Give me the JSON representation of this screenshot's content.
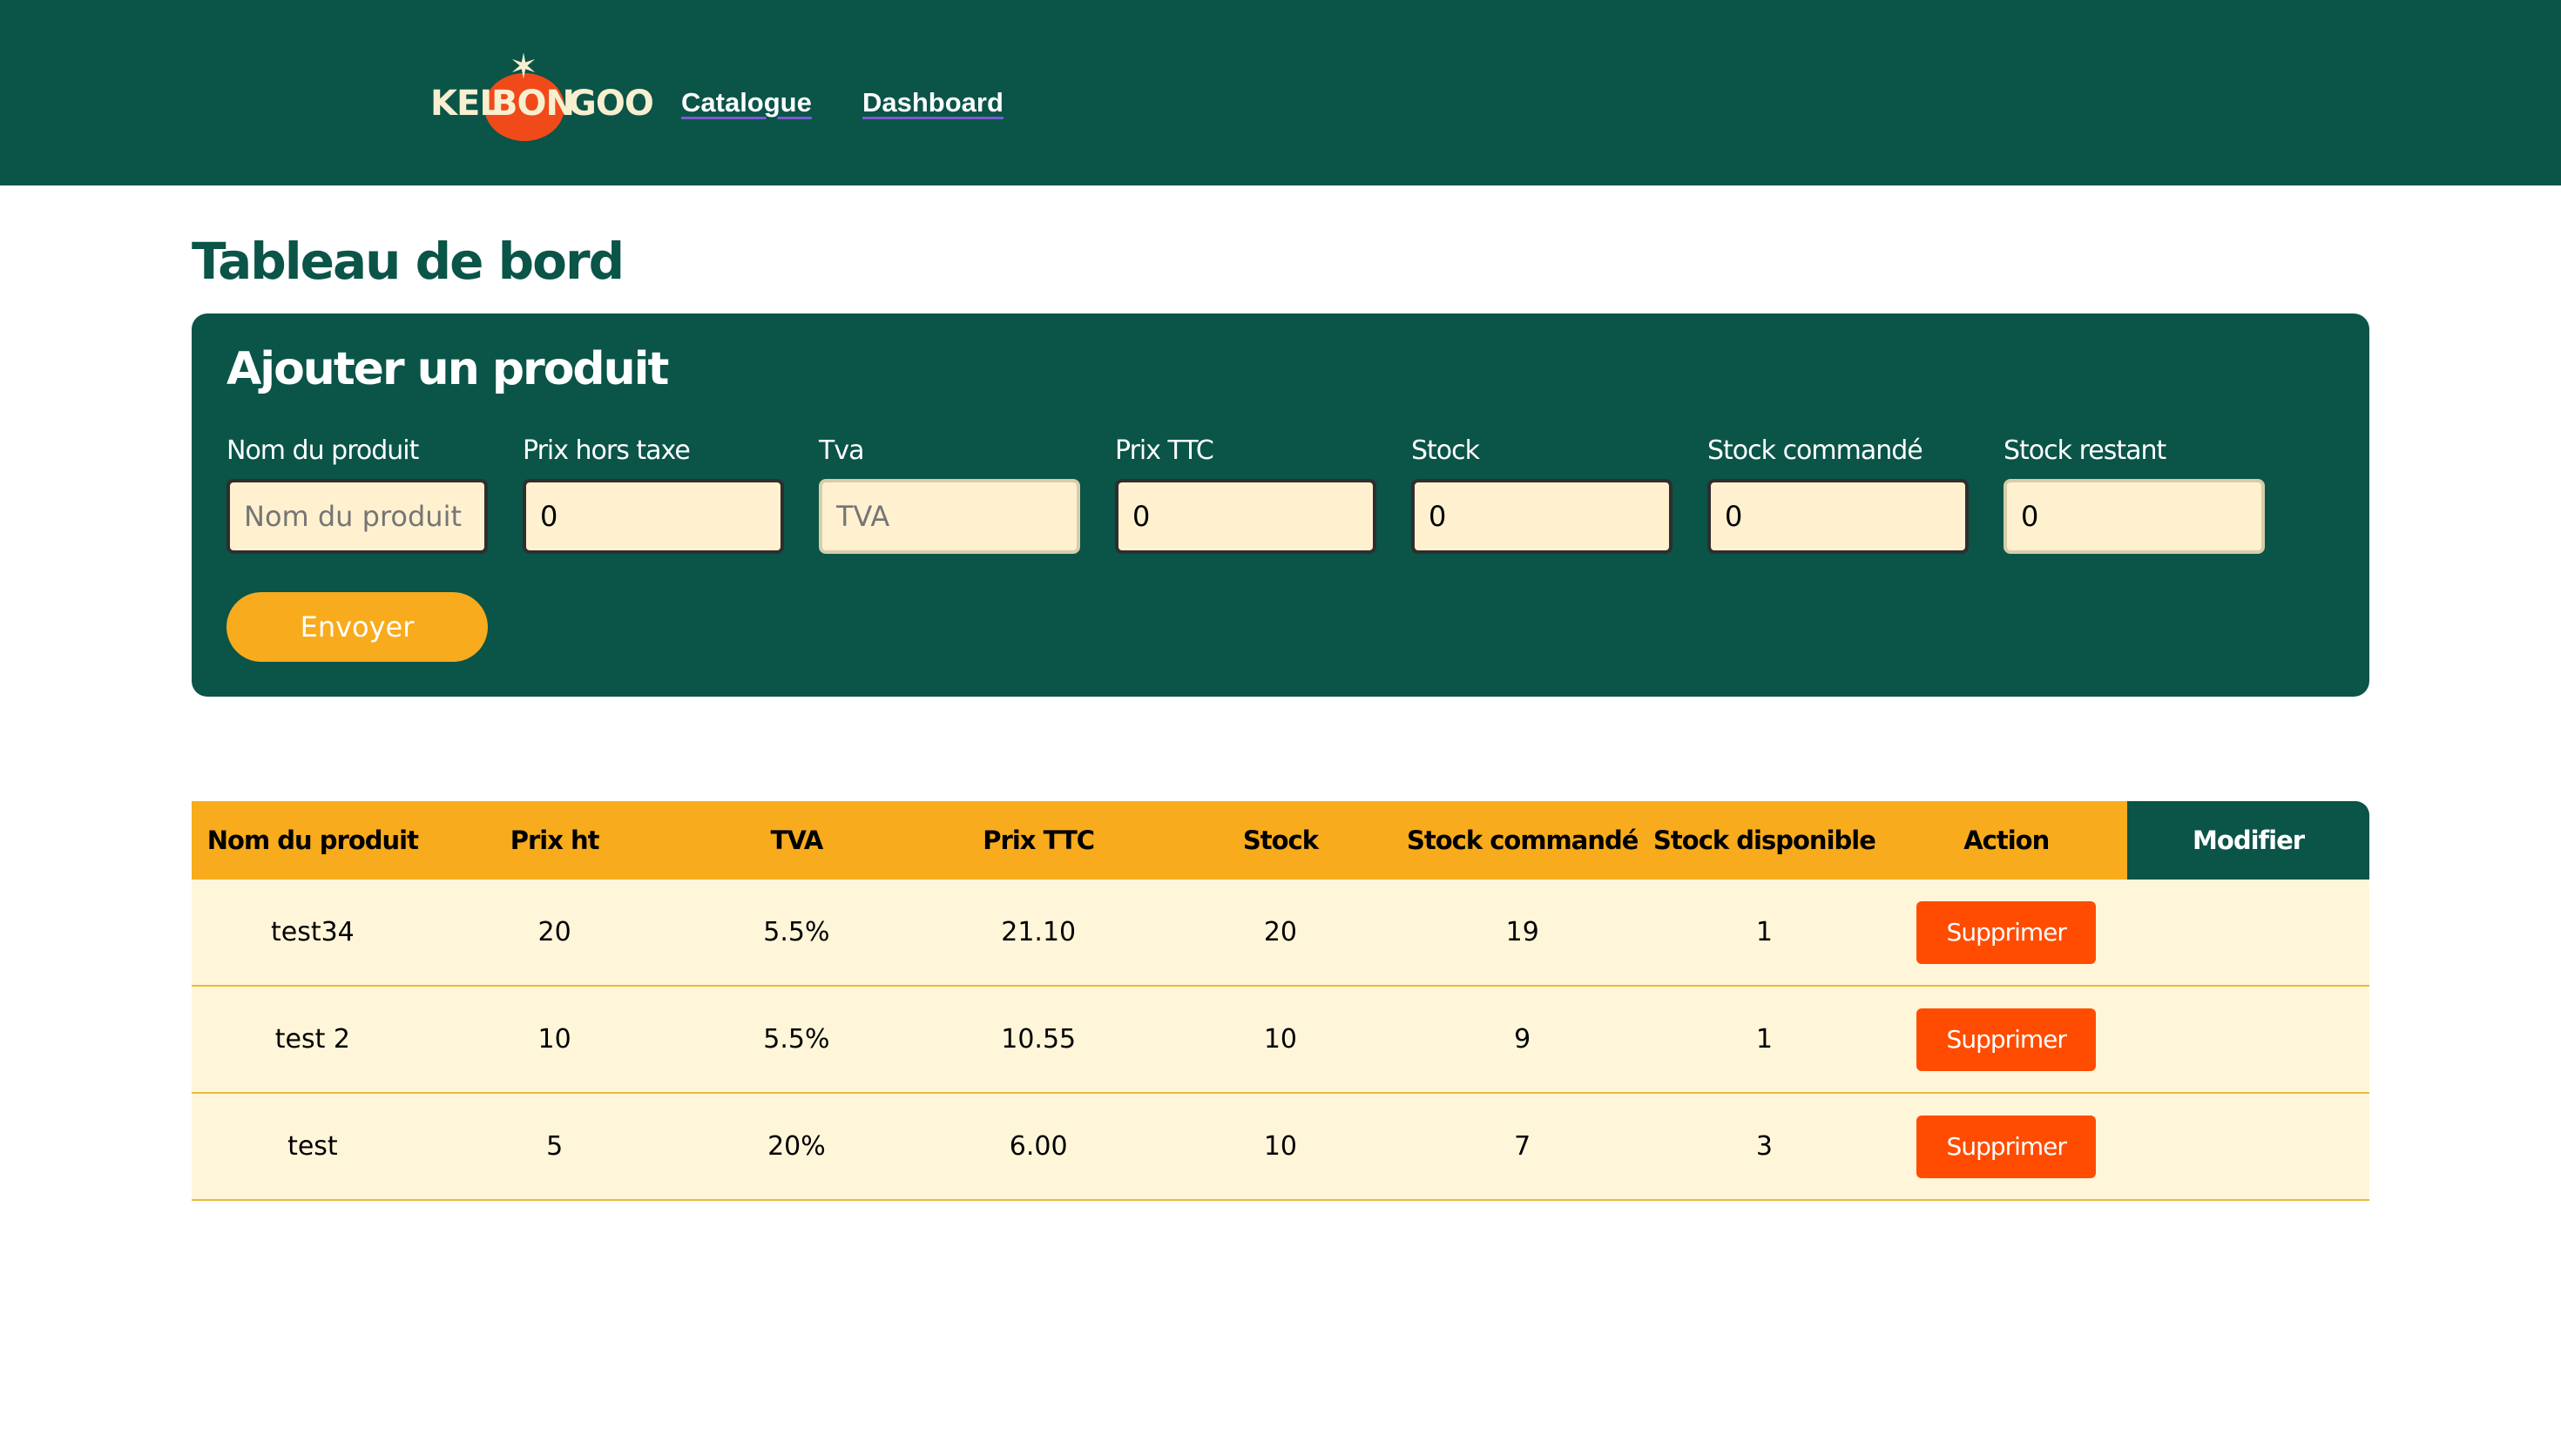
{
  "header": {
    "logo": {
      "part1": "KEL",
      "part2": "BON",
      "part3": "GOO"
    },
    "nav": [
      {
        "label": "Catalogue"
      },
      {
        "label": "Dashboard"
      }
    ]
  },
  "page": {
    "title": "Tableau de bord"
  },
  "form": {
    "title": "Ajouter un produit",
    "fields": [
      {
        "label": "Nom du produit",
        "value": "",
        "placeholder": "Nom du produit"
      },
      {
        "label": "Prix hors taxe",
        "value": "0",
        "placeholder": ""
      },
      {
        "label": "Tva",
        "value": "",
        "placeholder": "TVA"
      },
      {
        "label": "Prix TTC",
        "value": "0",
        "placeholder": ""
      },
      {
        "label": "Stock",
        "value": "0",
        "placeholder": ""
      },
      {
        "label": "Stock commandé",
        "value": "0",
        "placeholder": ""
      },
      {
        "label": "Stock restant",
        "value": "0",
        "placeholder": ""
      }
    ],
    "submit_label": "Envoyer"
  },
  "table": {
    "headers": [
      "Nom du produit",
      "Prix ht",
      "TVA",
      "Prix TTC",
      "Stock",
      "Stock commandé",
      "Stock disponible",
      "Action",
      "Modifier"
    ],
    "rows": [
      {
        "name": "test34",
        "prix_ht": "20",
        "tva": "5.5%",
        "prix_ttc": "21.10",
        "stock": "20",
        "stock_commande": "19",
        "stock_disponible": "1",
        "action": "Supprimer"
      },
      {
        "name": "test 2",
        "prix_ht": "10",
        "tva": "5.5%",
        "prix_ttc": "10.55",
        "stock": "10",
        "stock_commande": "9",
        "stock_disponible": "1",
        "action": "Supprimer"
      },
      {
        "name": "test",
        "prix_ht": "5",
        "tva": "20%",
        "prix_ttc": "6.00",
        "stock": "10",
        "stock_commande": "7",
        "stock_disponible": "3",
        "action": "Supprimer"
      }
    ]
  },
  "colors": {
    "brand_green": "#0a5448",
    "accent_orange": "#f8ab1c",
    "danger": "#ff4c00",
    "input_bg": "#fff1d0",
    "row_bg": "#fff6da"
  }
}
